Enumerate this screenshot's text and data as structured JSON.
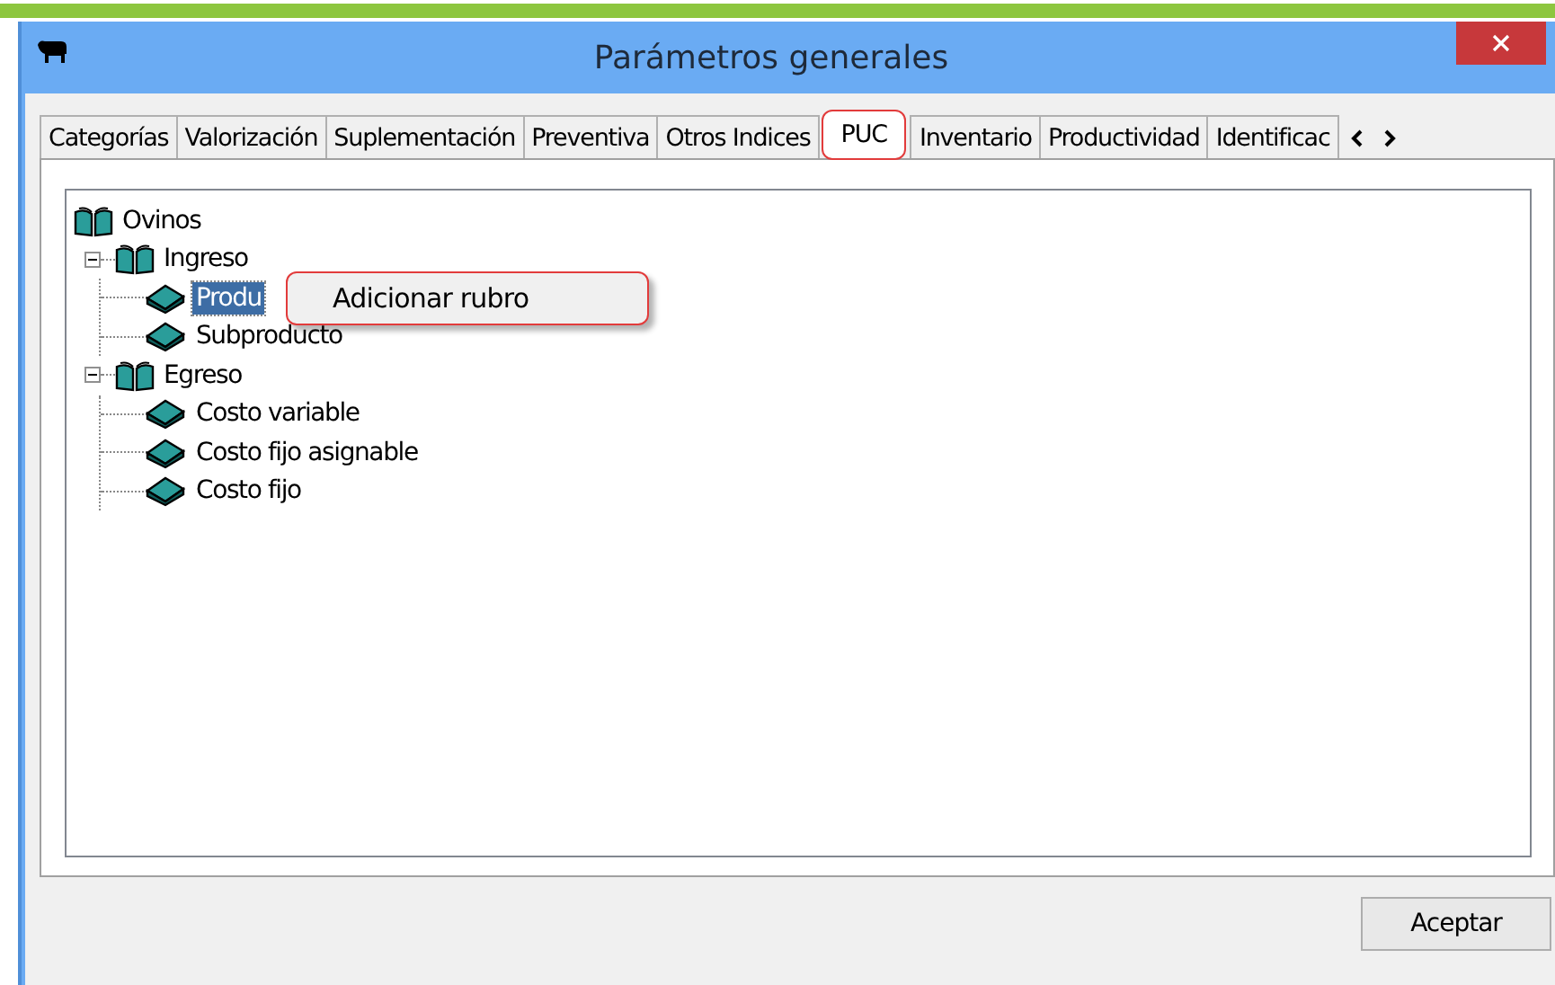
{
  "window": {
    "title": "Parámetros generales"
  },
  "tabs": [
    {
      "label": "Categorías",
      "selected": false
    },
    {
      "label": "Valorización",
      "selected": false
    },
    {
      "label": "Suplementación",
      "selected": false
    },
    {
      "label": "Preventiva",
      "selected": false
    },
    {
      "label": "Otros Indices",
      "selected": false
    },
    {
      "label": "PUC",
      "selected": true
    },
    {
      "label": "Inventario",
      "selected": false
    },
    {
      "label": "Productividad",
      "selected": false
    },
    {
      "label": "Identificac",
      "selected": false
    }
  ],
  "tree": {
    "label": "Ovinos",
    "children": [
      {
        "label": "Ingreso",
        "expanded": true,
        "children": [
          {
            "label": "Produ",
            "selected": true
          },
          {
            "label": "Subproducto",
            "selected": false
          }
        ]
      },
      {
        "label": "Egreso",
        "expanded": true,
        "children": [
          {
            "label": "Costo variable",
            "selected": false
          },
          {
            "label": "Costo fijo asignable",
            "selected": false
          },
          {
            "label": "Costo fijo",
            "selected": false
          }
        ]
      }
    ]
  },
  "context_menu": {
    "items": [
      "Adicionar rubro"
    ]
  },
  "buttons": [
    "Aceptar"
  ]
}
